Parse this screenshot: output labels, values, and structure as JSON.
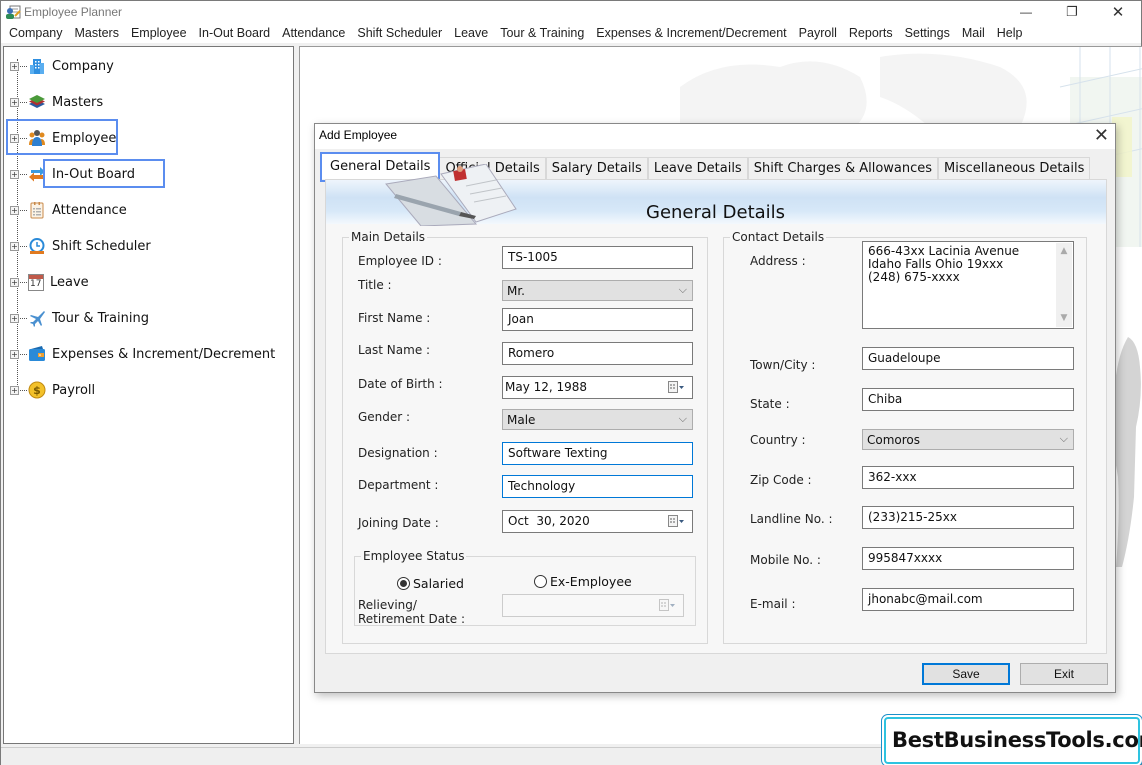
{
  "window": {
    "title": "Employee Planner",
    "controls": {
      "minimize": "—",
      "restore": "❐",
      "close": "✕"
    }
  },
  "menubar": [
    "Company",
    "Masters",
    "Employee",
    "In-Out Board",
    "Attendance",
    "Shift Scheduler",
    "Leave",
    "Tour & Training",
    "Expenses & Increment/Decrement",
    "Payroll",
    "Reports",
    "Settings",
    "Mail",
    "Help"
  ],
  "tree": [
    {
      "label": "Company",
      "icon": "building-icon"
    },
    {
      "label": "Masters",
      "icon": "layers-icon"
    },
    {
      "label": "Employee",
      "icon": "people-icon"
    },
    {
      "label": "In-Out Board",
      "icon": "swap-arrows-icon"
    },
    {
      "label": "Attendance",
      "icon": "clipboard-icon"
    },
    {
      "label": "Shift Scheduler",
      "icon": "clock-icon"
    },
    {
      "label": "Leave",
      "icon": "calendar-icon"
    },
    {
      "label": "Tour & Training",
      "icon": "airplane-icon"
    },
    {
      "label": "Expenses & Increment/Decrement",
      "icon": "wallet-icon"
    },
    {
      "label": "Payroll",
      "icon": "dollar-coin-icon"
    }
  ],
  "tree_expander": "+",
  "calendar_day": "17",
  "dialog": {
    "title": "Add Employee",
    "close": "✕",
    "tabs": [
      "General Details",
      "Official Details",
      "Salary Details",
      "Leave Details",
      "Shift Charges & Allowances",
      "Miscellaneous Details"
    ],
    "active_tab": "General Details",
    "banner_title": "General Details",
    "main_details": {
      "legend": "Main Details",
      "employee_id": {
        "label": "Employee ID :",
        "value": "TS-1005"
      },
      "title": {
        "label": "Title :",
        "value": "Mr."
      },
      "first_name": {
        "label": "First Name :",
        "value": "Joan"
      },
      "last_name": {
        "label": "Last Name :",
        "value": "Romero"
      },
      "dob": {
        "label": "Date of Birth :",
        "value": "May 12, 1988"
      },
      "gender": {
        "label": "Gender :",
        "value": "Male"
      },
      "designation": {
        "label": "Designation :",
        "value": "Software Texting"
      },
      "department": {
        "label": "Department :",
        "value": "Technology"
      },
      "joining_date": {
        "label": "Joining Date :",
        "value": "Oct  30, 2020"
      }
    },
    "employee_status": {
      "legend": "Employee Status",
      "options": [
        "Salaried",
        "Ex-Employee"
      ],
      "selected": "Salaried",
      "relieving_label_1": "Relieving/",
      "relieving_label_2": "Retirement Date :",
      "relieving_value": ""
    },
    "contact_details": {
      "legend": "Contact Details",
      "address": {
        "label": "Address :",
        "lines": [
          "666-43xx Lacinia Avenue",
          "Idaho Falls Ohio 19xxx",
          "(248) 675-xxxx"
        ]
      },
      "town": {
        "label": "Town/City :",
        "value": "Guadeloupe"
      },
      "state": {
        "label": "State :",
        "value": "Chiba"
      },
      "country": {
        "label": "Country :",
        "value": "Comoros"
      },
      "zip": {
        "label": "Zip Code :",
        "value": "362-xxx"
      },
      "landline": {
        "label": "Landline No. :",
        "value": "(233)215-25xx"
      },
      "mobile": {
        "label": "Mobile No. :",
        "value": "995847xxxx"
      },
      "email": {
        "label": "E-mail :",
        "value": "jhonabc@mail.com"
      }
    },
    "buttons": {
      "save": "Save",
      "exit": "Exit"
    }
  },
  "watermark": "BestBusinessTools.com",
  "colors": {
    "highlight": "#5b8def",
    "focus": "#0078d7",
    "watermark_border": "#2ec3e0"
  }
}
